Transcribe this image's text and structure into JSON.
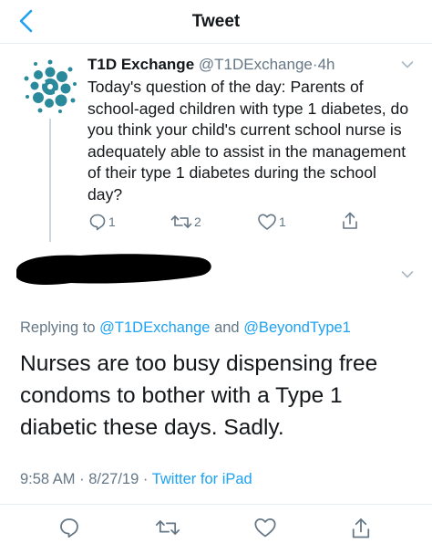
{
  "nav": {
    "title": "Tweet"
  },
  "parent_tweet": {
    "display_name": "T1D Exchange",
    "handle": "@T1DExchange",
    "dot": "·",
    "time": "4h",
    "text": "Today's question of the day: Parents of school-aged children with type 1 diabetes, do you think your child's current school nurse is adequately able to assist in the management of their type 1 diabetes during the school day?",
    "replies": "1",
    "retweets": "2",
    "likes": "1",
    "icons": [
      "reply-icon",
      "retweet-icon",
      "like-icon",
      "share-icon"
    ]
  },
  "main_tweet": {
    "replying_prefix": "Replying to",
    "replying_to_1": "@T1DExchange",
    "and": "and",
    "replying_to_2": "@BeyondType1",
    "text": "Nurses are too busy dispensing free condoms to bother with a Type 1 diabetic these days. Sadly.",
    "time": "9:58 AM",
    "date": "8/27/19",
    "dot": "·",
    "source": "Twitter for iPad"
  },
  "colors": {
    "accent": "#1da1f2",
    "muted": "#657786",
    "text": "#14171a",
    "avatar": "#2a8a9b"
  }
}
